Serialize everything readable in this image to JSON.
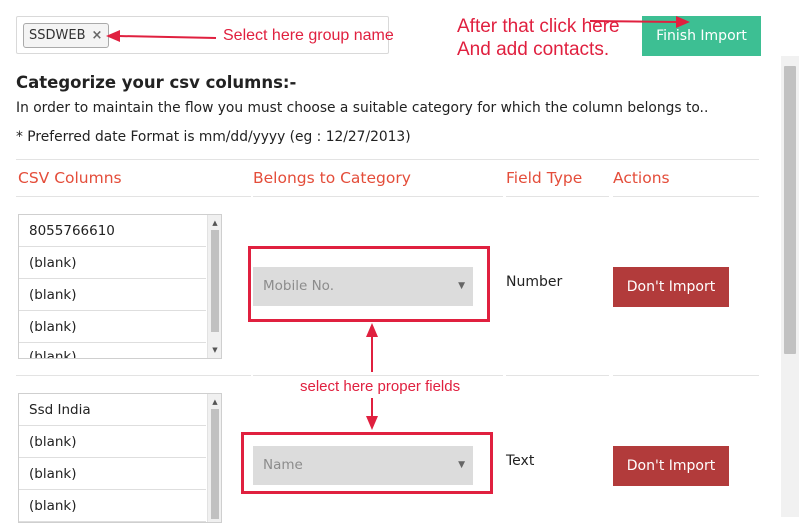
{
  "group": {
    "tag_label": "SSDWEB",
    "remove_glyph": "×"
  },
  "finish_button": "Finish Import",
  "heading": "Categorize your csv columns:-",
  "description": "In order to maintain the flow you must choose a suitable category for which the column belongs to..",
  "date_format_note": "* Preferred date Format is mm/dd/yyyy (eg : 12/27/2013)",
  "table_headers": {
    "csv_columns": "CSV Columns",
    "belongs_to_category": "Belongs to Category",
    "field_type": "Field Type",
    "actions": "Actions"
  },
  "rows": [
    {
      "csv_values": [
        "8055766610",
        "(blank)",
        "(blank)",
        "(blank)",
        "(blank)"
      ],
      "category": "Mobile No.",
      "field_type": "Number",
      "action": "Don't Import"
    },
    {
      "csv_values": [
        "Ssd India",
        "(blank)",
        "(blank)",
        "(blank)"
      ],
      "category": "Name",
      "field_type": "Text",
      "action": "Don't Import"
    }
  ],
  "annotations": {
    "group_hint": "Select here  group name",
    "finish_hint_line1": "After that click here",
    "finish_hint_line2": "And add contacts.",
    "fields_hint": "select here proper fields"
  },
  "colors": {
    "accent_header": "#e44d3a",
    "finish_button_bg": "#3dbf93",
    "dont_import_bg": "#b23b3b",
    "annotation_red": "#e0203f"
  },
  "icons": {
    "select_caret": "▼",
    "scroll_up": "▲",
    "scroll_down": "▼"
  }
}
